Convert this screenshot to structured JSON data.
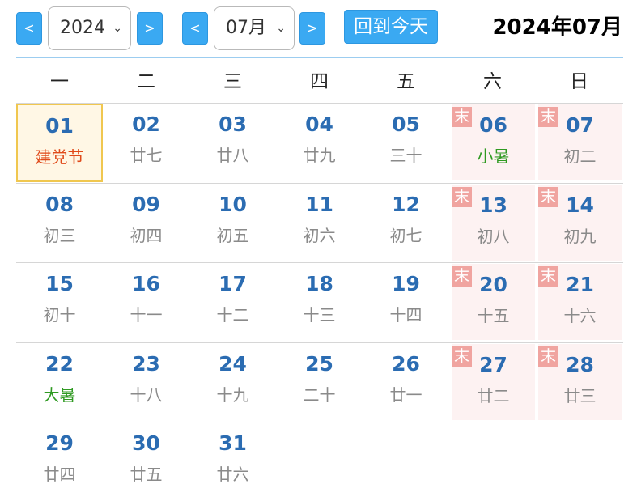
{
  "toolbar": {
    "prev_year": "<",
    "year": "2024",
    "next_year": ">",
    "prev_month": "<",
    "month": "07月",
    "next_month": ">",
    "today_label": "回到今天",
    "title": "2024年07月"
  },
  "weekdays": [
    "一",
    "二",
    "三",
    "四",
    "五",
    "六",
    "日"
  ],
  "weekend_badge": "末",
  "weeks": [
    [
      {
        "day": "01",
        "lunar": "建党节",
        "kind": "festival",
        "today": true
      },
      {
        "day": "02",
        "lunar": "廿七"
      },
      {
        "day": "03",
        "lunar": "廿八"
      },
      {
        "day": "04",
        "lunar": "廿九"
      },
      {
        "day": "05",
        "lunar": "三十"
      },
      {
        "day": "06",
        "lunar": "小暑",
        "kind": "term",
        "weekend": true
      },
      {
        "day": "07",
        "lunar": "初二",
        "weekend": true
      }
    ],
    [
      {
        "day": "08",
        "lunar": "初三"
      },
      {
        "day": "09",
        "lunar": "初四"
      },
      {
        "day": "10",
        "lunar": "初五"
      },
      {
        "day": "11",
        "lunar": "初六"
      },
      {
        "day": "12",
        "lunar": "初七"
      },
      {
        "day": "13",
        "lunar": "初八",
        "weekend": true
      },
      {
        "day": "14",
        "lunar": "初九",
        "weekend": true
      }
    ],
    [
      {
        "day": "15",
        "lunar": "初十"
      },
      {
        "day": "16",
        "lunar": "十一"
      },
      {
        "day": "17",
        "lunar": "十二"
      },
      {
        "day": "18",
        "lunar": "十三"
      },
      {
        "day": "19",
        "lunar": "十四"
      },
      {
        "day": "20",
        "lunar": "十五",
        "weekend": true
      },
      {
        "day": "21",
        "lunar": "十六",
        "weekend": true
      }
    ],
    [
      {
        "day": "22",
        "lunar": "大暑",
        "kind": "term"
      },
      {
        "day": "23",
        "lunar": "十八"
      },
      {
        "day": "24",
        "lunar": "十九"
      },
      {
        "day": "25",
        "lunar": "二十"
      },
      {
        "day": "26",
        "lunar": "廿一"
      },
      {
        "day": "27",
        "lunar": "廿二",
        "weekend": true
      },
      {
        "day": "28",
        "lunar": "廿三",
        "weekend": true
      }
    ],
    [
      {
        "day": "29",
        "lunar": "廿四"
      },
      {
        "day": "30",
        "lunar": "廿五"
      },
      {
        "day": "31",
        "lunar": "廿六"
      }
    ]
  ]
}
